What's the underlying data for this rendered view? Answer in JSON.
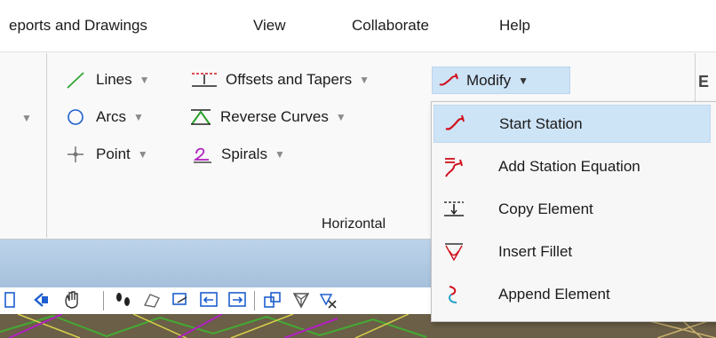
{
  "menubar": {
    "items": [
      {
        "label": "eports and Drawings"
      },
      {
        "label": "View"
      },
      {
        "label": "Collaborate"
      },
      {
        "label": "Help"
      }
    ]
  },
  "ribbon": {
    "lines_label": "Lines",
    "offsets_label": "Offsets and Tapers",
    "modify_label": "Modify",
    "arcs_label": "Arcs",
    "reverse_curves_label": "Reverse Curves",
    "point_label": "Point",
    "spirals_label": "Spirals",
    "group_label": "Horizontal",
    "dropdown_arrow": "▼"
  },
  "modify_menu": {
    "items": [
      {
        "label": "Start Station",
        "icon": "start-station-icon",
        "highlighted": true
      },
      {
        "label": "Add Station Equation",
        "icon": "station-equation-icon"
      },
      {
        "label": "Copy Element",
        "icon": "copy-element-icon"
      },
      {
        "label": "Insert Fillet",
        "icon": "insert-fillet-icon"
      },
      {
        "label": "Append Element",
        "icon": "append-element-icon"
      }
    ]
  },
  "colors": {
    "highlight": "#cde3f6",
    "red_icon": "#d0101a",
    "blue_icon": "#1e5fcf",
    "view_bar": "#b0c8e2"
  }
}
